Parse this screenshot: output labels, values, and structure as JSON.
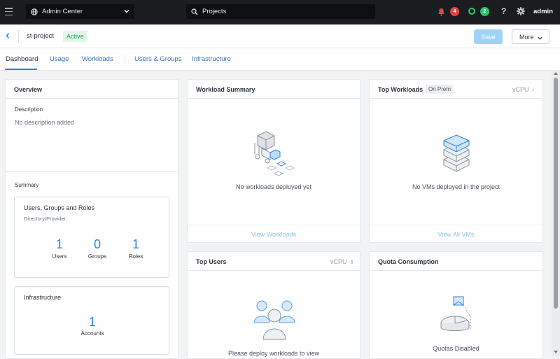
{
  "topbar": {
    "app_name": "Admin Center",
    "search_value": "Projects",
    "alerts_count": "4",
    "tasks_count": "2",
    "help_label": "?",
    "user_name": "admin",
    "icons": [
      "hamburger-icon",
      "globe-icon",
      "chevron-down-icon",
      "search-icon",
      "bell-icon",
      "tasks-ring-icon",
      "help-icon",
      "gear-icon"
    ]
  },
  "header": {
    "project_name": "st-project",
    "status": "Active",
    "save_label": "Save",
    "more_label": "More"
  },
  "tabs": [
    {
      "label": "Dashboard",
      "active": true
    },
    {
      "label": "Usage"
    },
    {
      "label": "Workloads"
    },
    {
      "label": "Users & Groups"
    },
    {
      "label": "Infrastructure"
    }
  ],
  "overview": {
    "title": "Overview",
    "description_label": "Description",
    "description_value": "No description added",
    "summary_label": "Summary",
    "ugr": {
      "title": "Users, Groups and Roles",
      "provider_label": "Directory/Provider:",
      "stats": [
        {
          "value": "1",
          "label": "Users"
        },
        {
          "value": "0",
          "label": "Groups"
        },
        {
          "value": "1",
          "label": "Roles"
        }
      ]
    },
    "infra": {
      "title": "Infrastructure",
      "accounts_value": "1",
      "accounts_label": "Accounts"
    }
  },
  "workload_summary": {
    "title": "Workload Summary",
    "empty_text": "No workloads deployed yet",
    "link": "View Workloads"
  },
  "top_workloads": {
    "title": "Top Workloads",
    "pill": "On Prem",
    "metric": "vCPU",
    "empty_text": "No VMs deployed in the project",
    "link": "View All VMs"
  },
  "top_users": {
    "title": "Top Users",
    "metric": "vCPU",
    "empty_text": "Please deploy workloads to view"
  },
  "quota": {
    "title": "Quota Consumption",
    "empty_text": "Quotas Disabled"
  },
  "colors": {
    "accent": "#2d7fe0",
    "active_green": "#22a35a",
    "alert_red": "#e04545",
    "task_green": "#2bc46b",
    "topbar_bg": "#1b1c20"
  }
}
